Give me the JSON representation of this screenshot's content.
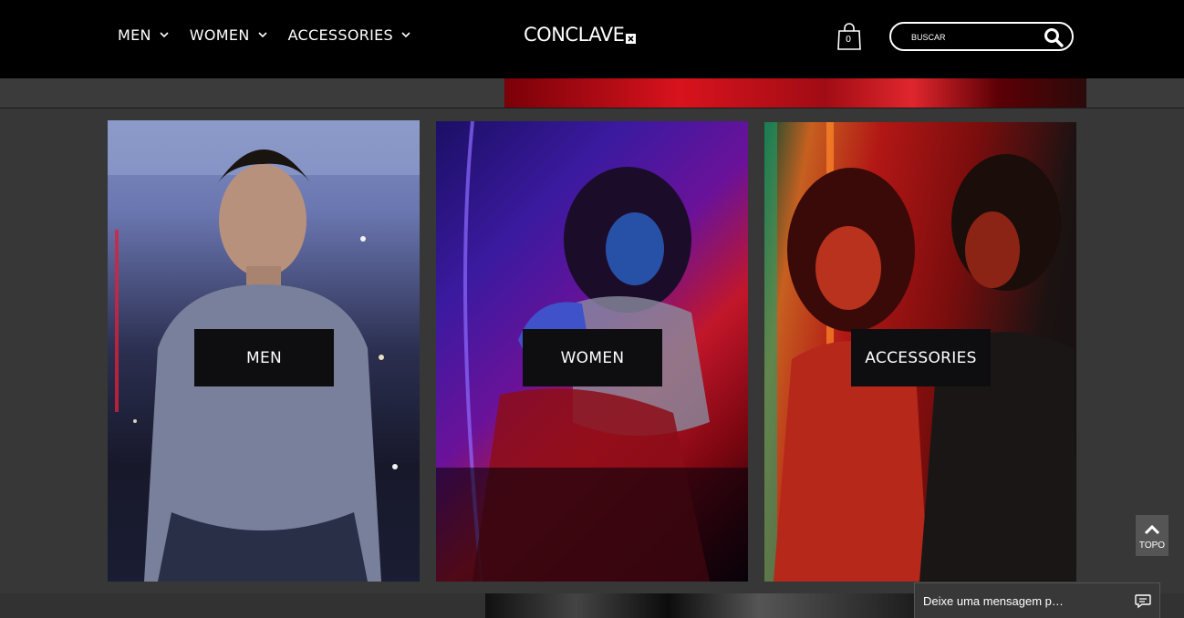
{
  "header": {
    "nav": [
      {
        "label": "MEN"
      },
      {
        "label": "WOMEN"
      },
      {
        "label": "ACCESSORIES"
      }
    ],
    "logo_text": "CONCLAVE",
    "cart_count": "0",
    "search": {
      "placeholder": "BUSCAR"
    }
  },
  "categories": [
    {
      "label": "MEN"
    },
    {
      "label": "WOMEN"
    },
    {
      "label": "ACCESSORIES"
    }
  ],
  "scroll_top": {
    "label": "TOPO"
  },
  "chat": {
    "label": "Deixe uma mensagem p…"
  }
}
